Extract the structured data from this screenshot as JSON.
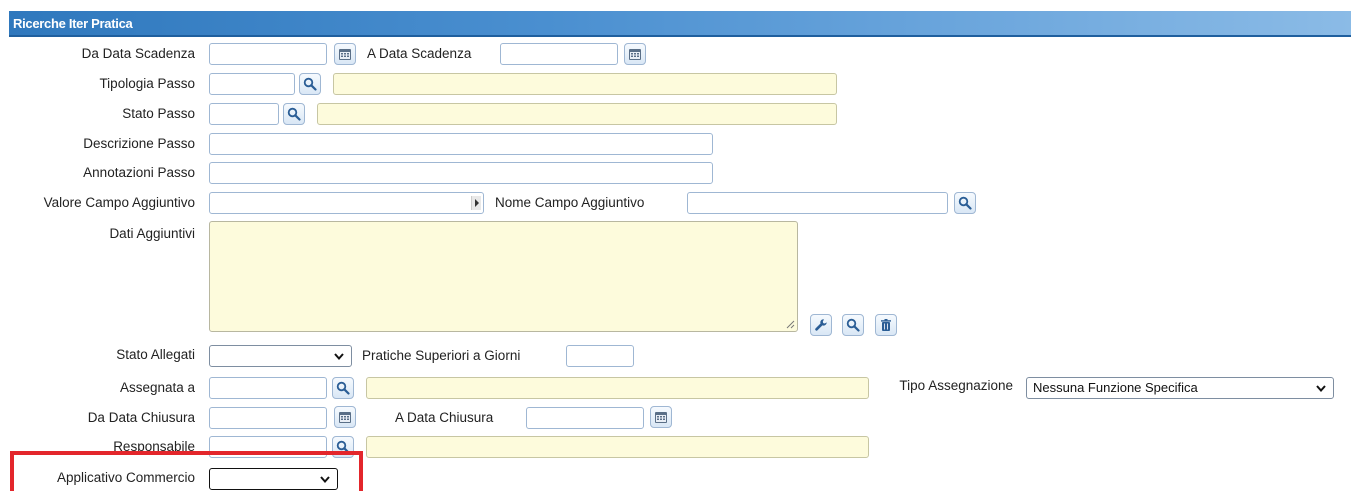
{
  "panel": {
    "title": "Ricerche Iter Pratica"
  },
  "form": {
    "da_data_scadenza": {
      "label": "Da Data Scadenza",
      "value": ""
    },
    "a_data_scadenza": {
      "label": "A Data Scadenza",
      "value": ""
    },
    "tipologia_passo": {
      "label": "Tipologia Passo",
      "code": "",
      "description": ""
    },
    "stato_passo": {
      "label": "Stato Passo",
      "code": "",
      "description": ""
    },
    "descrizione_passo": {
      "label": "Descrizione Passo",
      "value": ""
    },
    "annotazioni_passo": {
      "label": "Annotazioni Passo",
      "value": ""
    },
    "valore_campo_aggiuntivo": {
      "label": "Valore Campo Aggiuntivo",
      "value": ""
    },
    "nome_campo_aggiuntivo": {
      "label": "Nome Campo Aggiuntivo",
      "value": ""
    },
    "dati_aggiuntivi": {
      "label": "Dati Aggiuntivi",
      "value": ""
    },
    "stato_allegati": {
      "label": "Stato Allegati",
      "selected": ""
    },
    "pratiche_superiori": {
      "label": "Pratiche Superiori a Giorni",
      "value": ""
    },
    "assegnata_a": {
      "label": "Assegnata a",
      "code": "",
      "description": ""
    },
    "tipo_assegnazione": {
      "label": "Tipo Assegnazione",
      "selected": "Nessuna Funzione Specifica"
    },
    "da_data_chiusura": {
      "label": "Da Data Chiusura",
      "value": ""
    },
    "a_data_chiusura": {
      "label": "A Data Chiusura",
      "value": ""
    },
    "responsabile": {
      "label": "Responsabile",
      "code": "",
      "description": ""
    },
    "applicativo_commercio": {
      "label": "Applicativo Commercio",
      "selected": ""
    }
  },
  "icons": {
    "calendar": "calendar-icon",
    "search": "search-icon",
    "wrench": "wrench-icon",
    "trash": "trash-icon",
    "chevron": "chevron-down-icon"
  },
  "colors": {
    "header": "#2f78bd",
    "highlight": "#e3262b",
    "readonly_field": "#fdfbdc",
    "border": "#9fb7d3"
  }
}
